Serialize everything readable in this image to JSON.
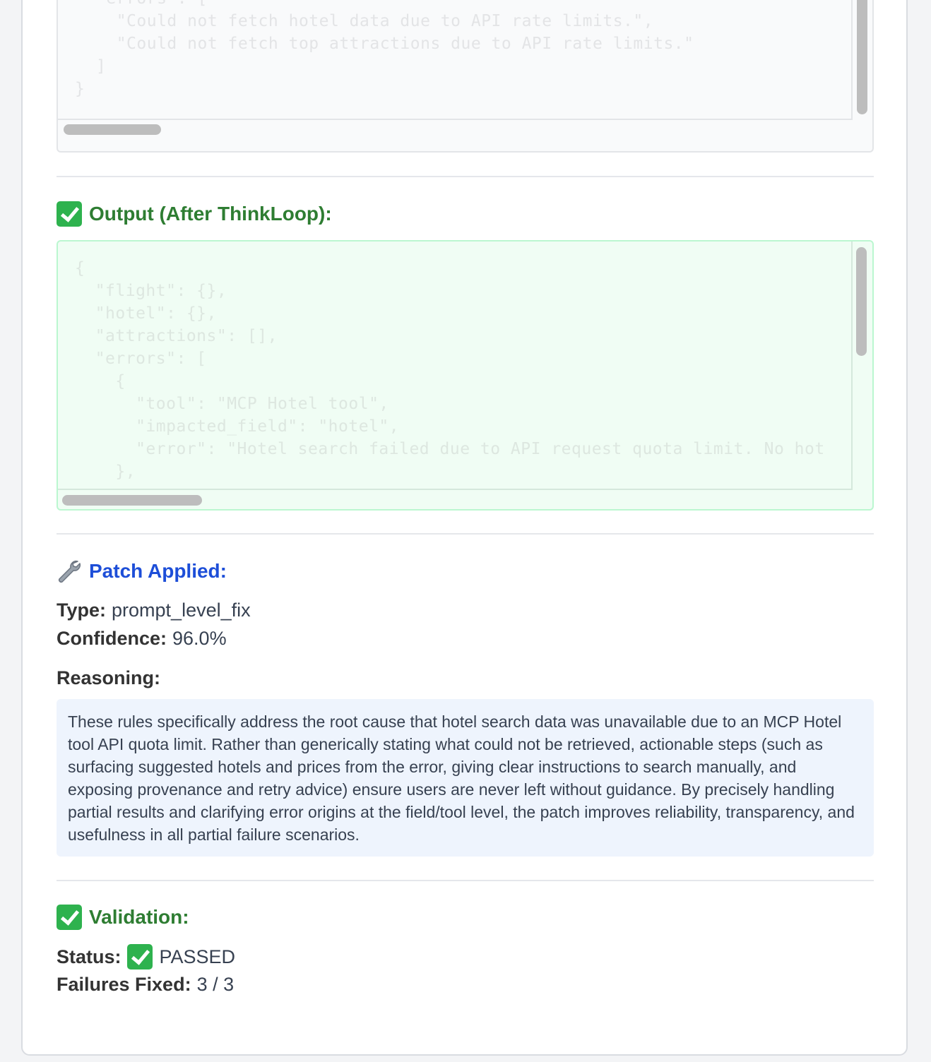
{
  "input_box": {
    "lines": [
      "\"errors\": [",
      "  \"Could not fetch hotel data due to API rate limits.\",",
      "  \"Could not fetch top attractions due to API rate limits.\"",
      "]",
      "}"
    ]
  },
  "output_section": {
    "title": "Output (After ThinkLoop):",
    "icon": "check-mark-button-icon",
    "lines": [
      "{",
      "  \"flight\": {},",
      "  \"hotel\": {},",
      "  \"attractions\": [],",
      "  \"errors\": [",
      "    {",
      "      \"tool\": \"MCP Hotel tool\",",
      "      \"impacted_field\": \"hotel\",",
      "      \"error\": \"Hotel search failed due to API request quota limit. No hot",
      "    },"
    ]
  },
  "patch_section": {
    "title": "Patch Applied:",
    "icon": "wrench-icon",
    "type_label": "Type:",
    "type_value": "prompt_level_fix",
    "confidence_label": "Confidence:",
    "confidence_value": "96.0%",
    "reasoning_label": "Reasoning:",
    "reasoning_text": "These rules specifically address the root cause that hotel search data was unavailable due to an MCP Hotel tool API quota limit. Rather than generically stating what could not be retrieved, actionable steps (such as surfacing suggested hotels and prices from the error, giving clear instructions to search manually, and exposing provenance and retry advice) ensure users are never left without guidance. By precisely handling partial results and clarifying error origins at the field/tool level, the patch improves reliability, transparency, and usefulness in all partial failure scenarios."
  },
  "validation_section": {
    "title": "Validation:",
    "icon": "check-mark-button-icon",
    "status_label": "Status:",
    "status_value": "PASSED",
    "failures_label": "Failures Fixed:",
    "failures_value": "3 / 3"
  },
  "colors": {
    "green_heading": "#2e7d32",
    "blue_heading": "#1d4ed8",
    "check_green": "#2eb24e",
    "reasoning_bg": "#eef4fd"
  }
}
